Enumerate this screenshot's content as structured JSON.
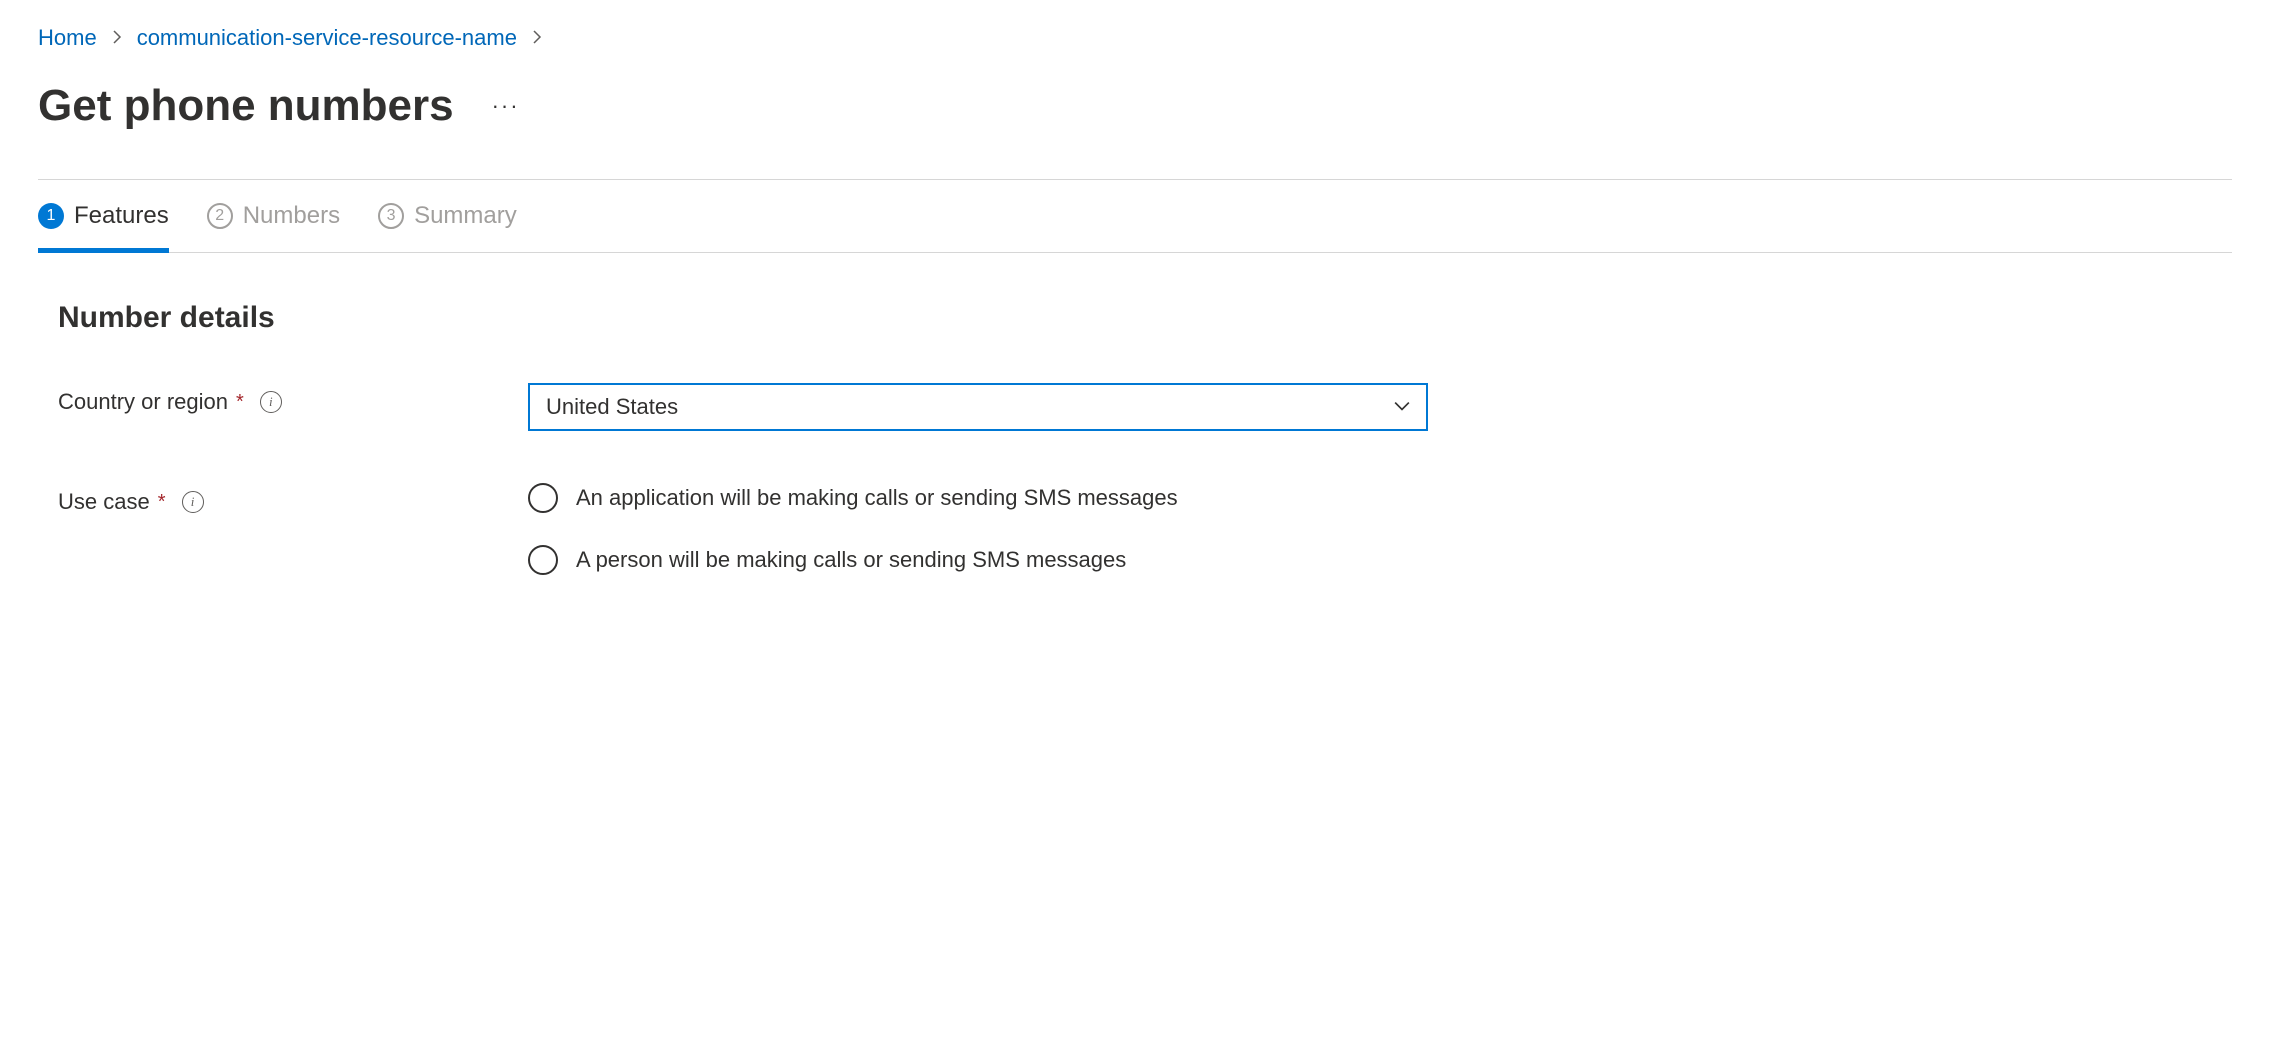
{
  "breadcrumb": {
    "home": "Home",
    "resource": "communication-service-resource-name"
  },
  "page": {
    "title": "Get phone numbers"
  },
  "tabs": [
    {
      "number": "1",
      "label": "Features",
      "active": true
    },
    {
      "number": "2",
      "label": "Numbers",
      "active": false
    },
    {
      "number": "3",
      "label": "Summary",
      "active": false
    }
  ],
  "section": {
    "title": "Number details"
  },
  "form": {
    "country": {
      "label": "Country or region",
      "value": "United States"
    },
    "usecase": {
      "label": "Use case",
      "options": [
        "An application will be making calls or sending SMS messages",
        "A person will be making calls or sending SMS messages"
      ]
    }
  }
}
